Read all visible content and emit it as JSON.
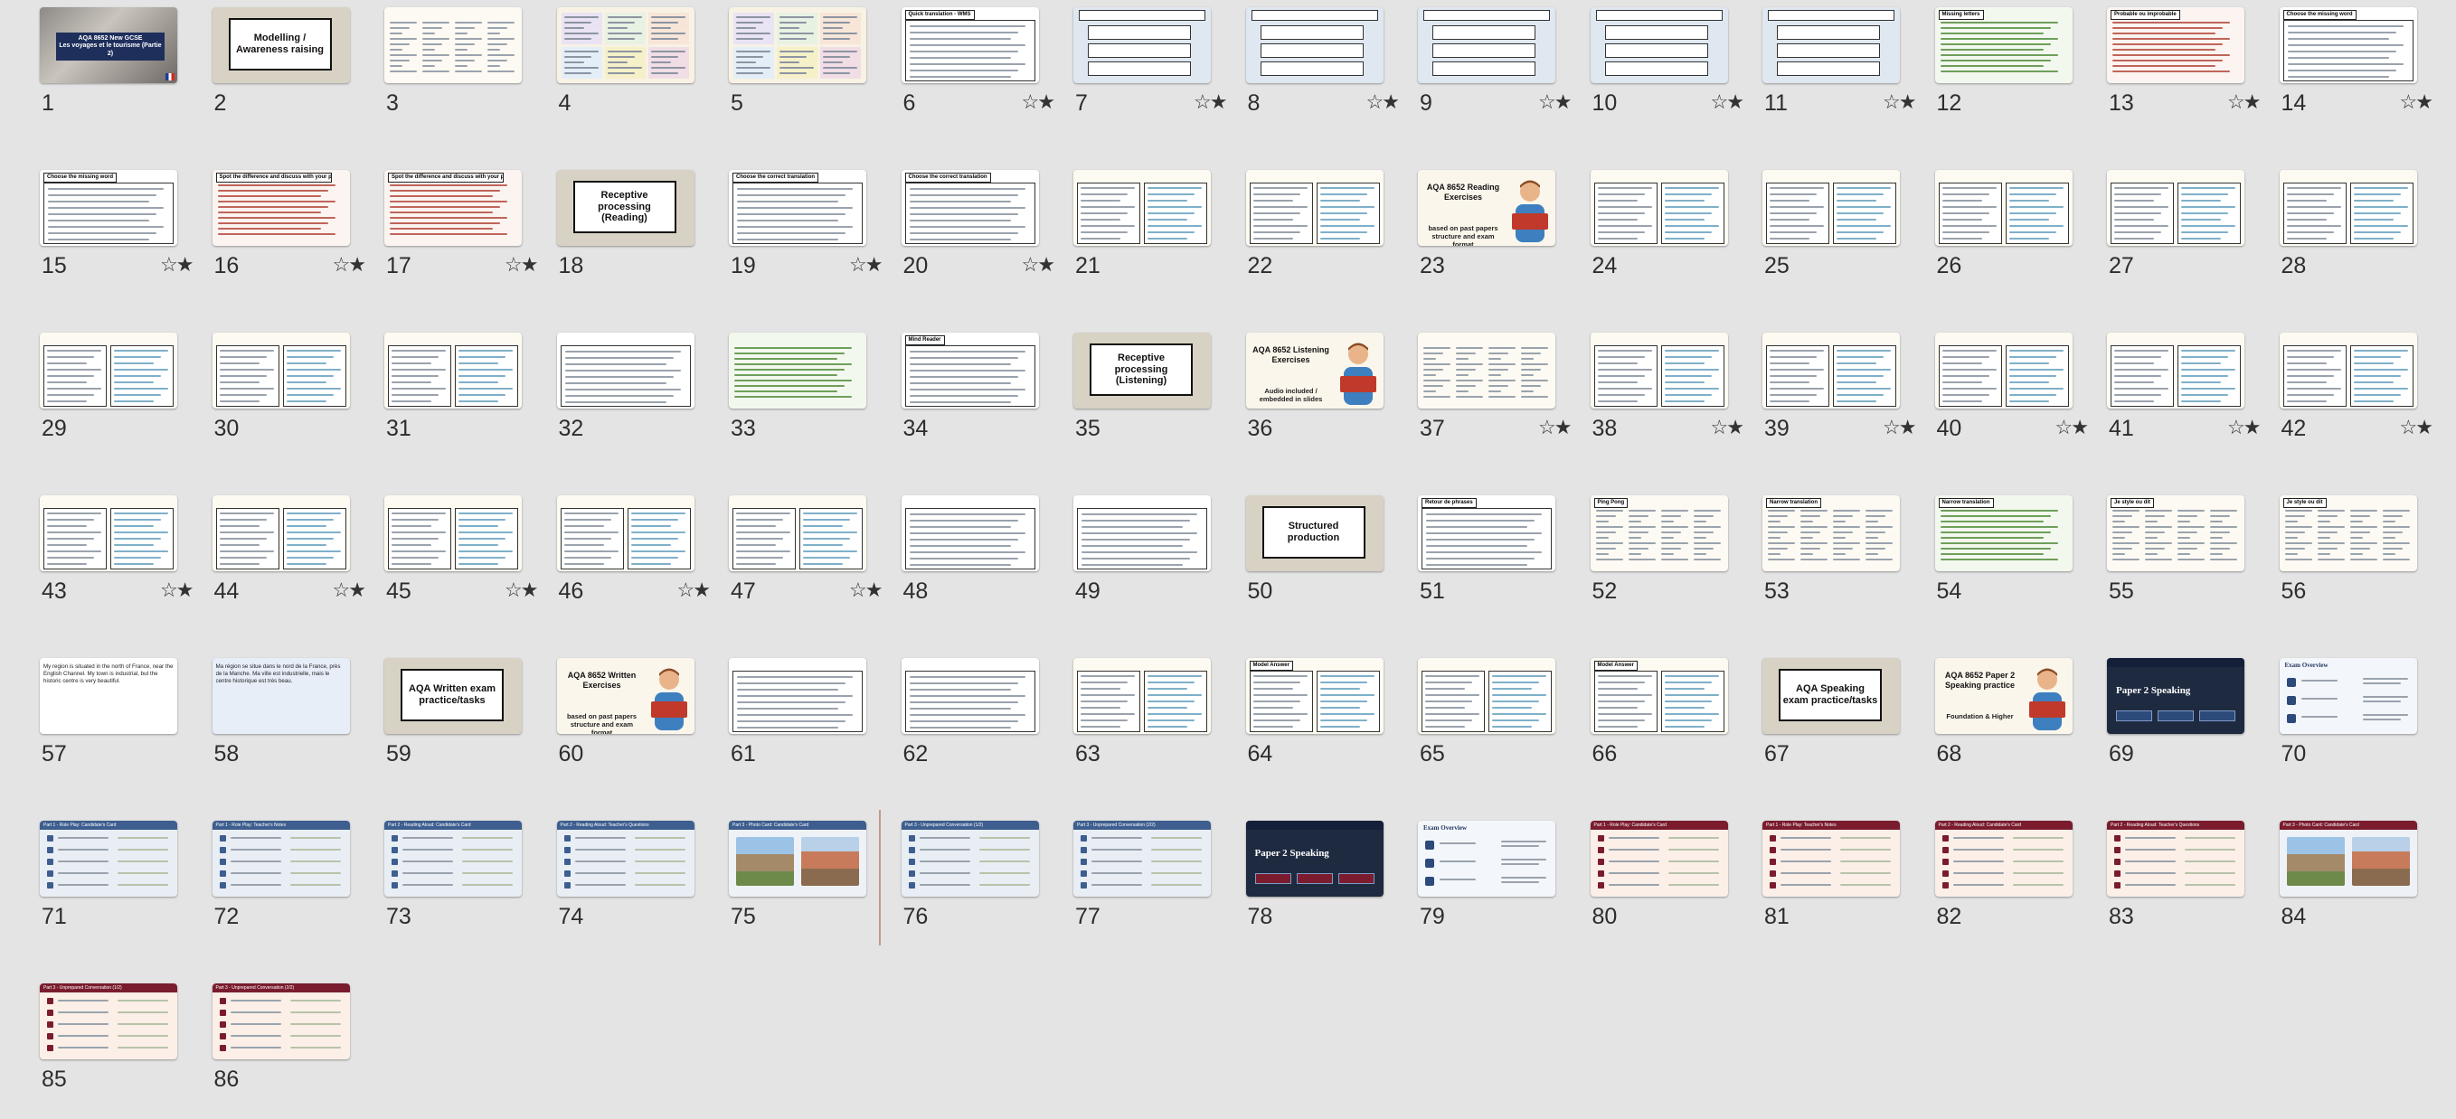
{
  "app": {
    "view": "slide-sorter"
  },
  "slides": [
    {
      "n": "1",
      "t": "cover",
      "star": false,
      "title": "AQA 8652 New GCSE",
      "sub": "Les voyages et le tourisme (Partie 2)"
    },
    {
      "n": "2",
      "t": "title",
      "star": false,
      "title": "Modelling / Awareness raising"
    },
    {
      "n": "3",
      "t": "table",
      "star": false
    },
    {
      "n": "4",
      "t": "colorgrid",
      "star": false
    },
    {
      "n": "5",
      "t": "colorgrid",
      "star": false
    },
    {
      "n": "6",
      "t": "list",
      "star": true,
      "hdr": "Quick translation - WMS"
    },
    {
      "n": "7",
      "t": "boxes",
      "star": true
    },
    {
      "n": "8",
      "t": "boxes",
      "star": true
    },
    {
      "n": "9",
      "t": "boxes",
      "star": true
    },
    {
      "n": "10",
      "t": "boxes",
      "star": true
    },
    {
      "n": "11",
      "t": "boxes",
      "star": true
    },
    {
      "n": "12",
      "t": "greenlist",
      "star": false,
      "hdr": "Missing letters"
    },
    {
      "n": "13",
      "t": "redlist",
      "star": true,
      "hdr": "Probable ou improbable"
    },
    {
      "n": "14",
      "t": "list",
      "star": true,
      "hdr": "Choose the missing word"
    },
    {
      "n": "15",
      "t": "list",
      "star": true,
      "hdr": "Choose the missing word"
    },
    {
      "n": "16",
      "t": "redlist",
      "star": true,
      "hdr": "Spot the difference and discuss with your partner"
    },
    {
      "n": "17",
      "t": "redlist",
      "star": true,
      "hdr": "Spot the difference and discuss with your partner"
    },
    {
      "n": "18",
      "t": "title",
      "star": false,
      "title": "Receptive processing (Reading)"
    },
    {
      "n": "19",
      "t": "list",
      "star": true,
      "hdr": "Choose the correct translation"
    },
    {
      "n": "20",
      "t": "list",
      "star": true,
      "hdr": "Choose the correct translation"
    },
    {
      "n": "21",
      "t": "twocol",
      "star": false
    },
    {
      "n": "22",
      "t": "twocol",
      "star": false
    },
    {
      "n": "23",
      "t": "illus",
      "star": false,
      "title": "AQA 8652 Reading Exercises",
      "sub": "based on past papers structure and exam format"
    },
    {
      "n": "24",
      "t": "twocol",
      "star": false
    },
    {
      "n": "25",
      "t": "twocol",
      "star": false
    },
    {
      "n": "26",
      "t": "twocol",
      "star": false
    },
    {
      "n": "27",
      "t": "twocol",
      "star": false
    },
    {
      "n": "28",
      "t": "twocol",
      "star": false
    },
    {
      "n": "29",
      "t": "twocol",
      "star": false
    },
    {
      "n": "30",
      "t": "twocol",
      "star": false
    },
    {
      "n": "31",
      "t": "twocol",
      "star": false
    },
    {
      "n": "32",
      "t": "list",
      "star": false
    },
    {
      "n": "33",
      "t": "greenlist",
      "star": false
    },
    {
      "n": "34",
      "t": "list",
      "star": false,
      "hdr": "Mind Reader"
    },
    {
      "n": "35",
      "t": "title",
      "star": false,
      "title": "Receptive processing (Listening)"
    },
    {
      "n": "36",
      "t": "illus",
      "star": false,
      "title": "AQA 8652 Listening Exercises",
      "sub": "Audio included / embedded in slides"
    },
    {
      "n": "37",
      "t": "table",
      "star": true
    },
    {
      "n": "38",
      "t": "twocol",
      "star": true
    },
    {
      "n": "39",
      "t": "twocol",
      "star": true
    },
    {
      "n": "40",
      "t": "twocol",
      "star": true
    },
    {
      "n": "41",
      "t": "twocol",
      "star": true
    },
    {
      "n": "42",
      "t": "twocol",
      "star": true
    },
    {
      "n": "43",
      "t": "twocol",
      "star": true
    },
    {
      "n": "44",
      "t": "twocol",
      "star": true
    },
    {
      "n": "45",
      "t": "twocol",
      "star": true
    },
    {
      "n": "46",
      "t": "twocol",
      "star": true
    },
    {
      "n": "47",
      "t": "twocol",
      "star": true
    },
    {
      "n": "48",
      "t": "list",
      "star": false
    },
    {
      "n": "49",
      "t": "list",
      "star": false
    },
    {
      "n": "50",
      "t": "title",
      "star": false,
      "title": "Structured production"
    },
    {
      "n": "51",
      "t": "list",
      "star": false,
      "hdr": "Retour de phrases"
    },
    {
      "n": "52",
      "t": "table",
      "star": false,
      "hdr": "Ping Pong"
    },
    {
      "n": "53",
      "t": "table",
      "star": false,
      "hdr": "Narrow translation"
    },
    {
      "n": "54",
      "t": "greenlist",
      "star": false,
      "hdr": "Narrow translation"
    },
    {
      "n": "55",
      "t": "table",
      "star": false,
      "hdr": "Je style ou dit"
    },
    {
      "n": "56",
      "t": "table",
      "star": false,
      "hdr": "Je style ou dit"
    },
    {
      "n": "57",
      "t": "para",
      "star": false,
      "body": "My region is situated in the north of France, near the English Channel. My town is industrial, but the historic centre is very beautiful."
    },
    {
      "n": "58",
      "t": "para",
      "star": false,
      "body": "Ma région se situe dans le nord de la France, près de la Manche. Ma ville est industrielle, mais le centre historique est très beau."
    },
    {
      "n": "59",
      "t": "title",
      "star": false,
      "title": "AQA Written exam practice/tasks"
    },
    {
      "n": "60",
      "t": "illus",
      "star": false,
      "title": "AQA 8652 Written Exercises",
      "sub": "based on past papers structure and exam format"
    },
    {
      "n": "61",
      "t": "list",
      "star": false
    },
    {
      "n": "62",
      "t": "list",
      "star": false
    },
    {
      "n": "63",
      "t": "twocol",
      "star": false
    },
    {
      "n": "64",
      "t": "twocol",
      "star": false,
      "hdr": "Model Answer"
    },
    {
      "n": "65",
      "t": "twocol",
      "star": false
    },
    {
      "n": "66",
      "t": "twocol",
      "star": false,
      "hdr": "Model Answer"
    },
    {
      "n": "67",
      "t": "title",
      "star": false,
      "title": "AQA Speaking exam practice/tasks"
    },
    {
      "n": "68",
      "t": "illus",
      "star": false,
      "title": "AQA 8652 Paper 2 Speaking practice",
      "sub": "Foundation & Higher"
    },
    {
      "n": "69",
      "t": "dark",
      "star": false,
      "title": "Paper 2 Speaking",
      "accent": "#2c4a7a"
    },
    {
      "n": "70",
      "t": "overview",
      "star": false,
      "hdr": "Exam Overview"
    },
    {
      "n": "71",
      "t": "blueband",
      "star": false,
      "hdr": "Part 1 - Role Play: Candidate's Card"
    },
    {
      "n": "72",
      "t": "blueband",
      "star": false,
      "hdr": "Part 1 - Role Play: Teacher's Notes"
    },
    {
      "n": "73",
      "t": "blueband",
      "star": false,
      "hdr": "Part 2 - Reading Aloud: Candidate's Card"
    },
    {
      "n": "74",
      "t": "blueband",
      "star": false,
      "hdr": "Part 2 - Reading Aloud: Teacher's Questions"
    },
    {
      "n": "75",
      "t": "photo",
      "star": false,
      "hdr": "Part 3 - Photo Card: Candidate's Card",
      "band": "#3d5e8f"
    },
    {
      "n": "76",
      "t": "blueband",
      "star": false,
      "hdr": "Part 3 - Unprepared Conversation (1/2)"
    },
    {
      "n": "77",
      "t": "blueband",
      "star": false,
      "hdr": "Part 3 - Unprepared Conversation (2/2)"
    },
    {
      "n": "78",
      "t": "dark",
      "star": false,
      "title": "Paper 2 Speaking",
      "accent": "#7a1c2e"
    },
    {
      "n": "79",
      "t": "overview",
      "star": false,
      "hdr": "Exam Overview"
    },
    {
      "n": "80",
      "t": "redband",
      "star": false,
      "hdr": "Part 1 - Role Play: Candidate's Card"
    },
    {
      "n": "81",
      "t": "redband",
      "star": false,
      "hdr": "Part 1 - Role Play: Teacher's Notes"
    },
    {
      "n": "82",
      "t": "redband",
      "star": false,
      "hdr": "Part 2 - Reading Aloud: Candidate's Card"
    },
    {
      "n": "83",
      "t": "redband",
      "star": false,
      "hdr": "Part 2 - Reading Aloud: Teacher's Questions"
    },
    {
      "n": "84",
      "t": "photo",
      "star": false,
      "hdr": "Part 3 - Photo Card: Candidate's Card",
      "band": "#7a1c2e"
    },
    {
      "n": "85",
      "t": "redband",
      "star": false,
      "hdr": "Part 3 - Unprepared Conversation (1/2)"
    },
    {
      "n": "86",
      "t": "redband",
      "star": false,
      "hdr": "Part 3 - Unprepared Conversation (2/2)"
    }
  ],
  "icons": {
    "transition": "star-transition-icon"
  },
  "colors": {
    "background": "#e4e4e4",
    "divider": "#c49a8a",
    "blue_theme": "#3d5e8f",
    "red_theme": "#7a1c2e"
  }
}
